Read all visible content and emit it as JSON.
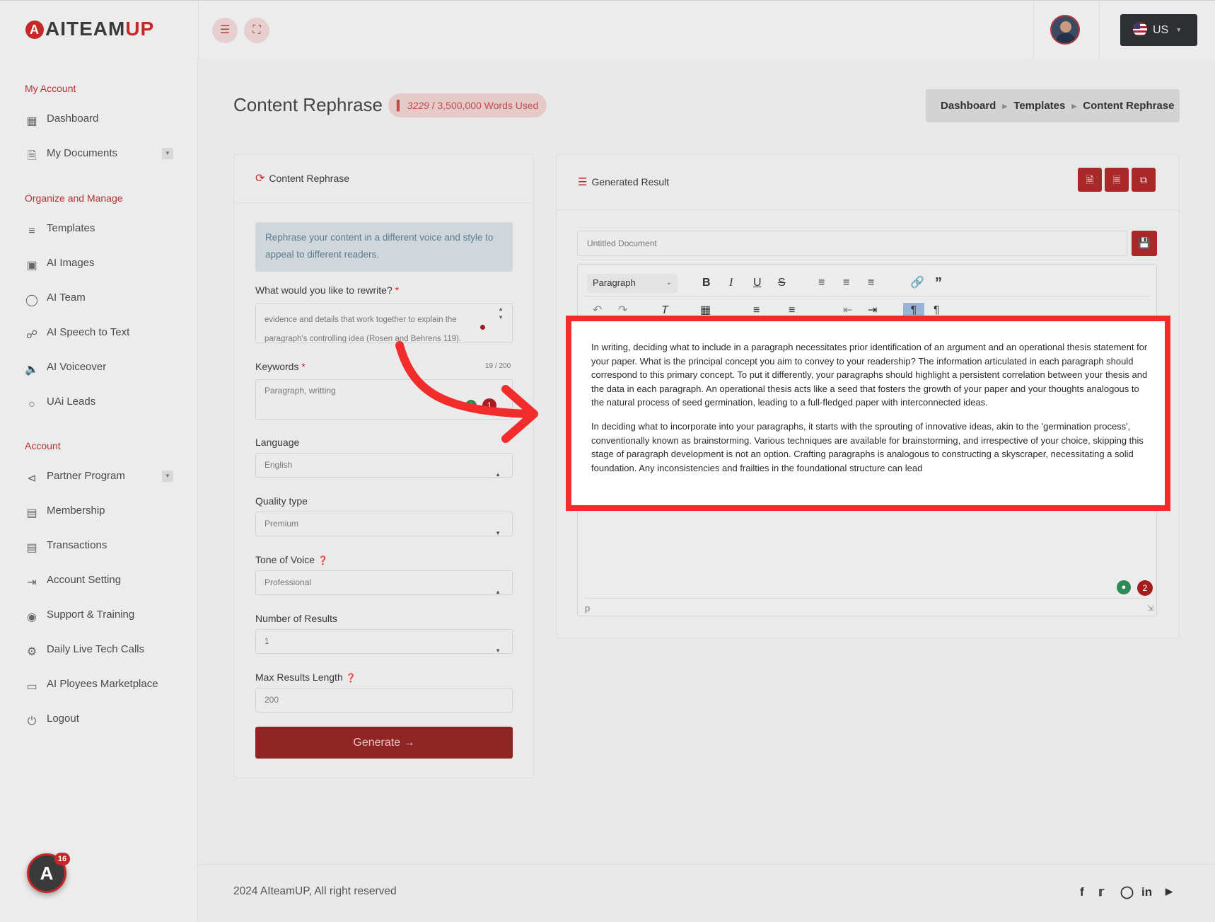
{
  "header": {
    "logo_text": "AITEAM",
    "logo_accent": "UP",
    "logo_mark": "A",
    "menu_icon": "hamburger-icon",
    "fullscreen_icon": "expand-icon",
    "language": "US"
  },
  "sidebar": {
    "sections": [
      {
        "title": "My Account"
      },
      {
        "title": "Organize and Manage"
      },
      {
        "title": "Account"
      }
    ],
    "items": [
      {
        "label": "Dashboard",
        "icon": "grid-icon"
      },
      {
        "label": "My Documents",
        "icon": "document-icon"
      },
      {
        "label": "Templates",
        "icon": "layers-icon"
      },
      {
        "label": "AI Images",
        "icon": "image-icon"
      },
      {
        "label": "AI Team",
        "icon": "chat-icon"
      },
      {
        "label": "AI Speech to Text",
        "icon": "headphones-icon"
      },
      {
        "label": "AI Voiceover",
        "icon": "speaker-icon"
      },
      {
        "label": "UAi Leads",
        "icon": "circle-icon"
      },
      {
        "label": "Partner Program",
        "icon": "share-icon"
      },
      {
        "label": "Membership",
        "icon": "gift-icon"
      },
      {
        "label": "Transactions",
        "icon": "receipt-icon"
      },
      {
        "label": "Account Setting",
        "icon": "exit-icon"
      },
      {
        "label": "Support & Training",
        "icon": "eye-icon"
      },
      {
        "label": "Daily Live Tech Calls",
        "icon": "gear-icon"
      },
      {
        "label": "AI Ployees Marketplace",
        "icon": "monitor-icon"
      },
      {
        "label": "Logout",
        "icon": "power-icon"
      }
    ],
    "help_badge_count": "16"
  },
  "page": {
    "title": "Content Rephrase",
    "words_used": "3229",
    "words_total": "/ 3,500,000 Words Used",
    "breadcrumb": [
      "Dashboard",
      "Templates",
      "Content Rephrase"
    ]
  },
  "form": {
    "card_title": "Content Rephrase",
    "info": "Rephrase your content in a different voice and style to appeal to different readers.",
    "rewrite_label": "What would you like to rewrite?",
    "rewrite_value": "evidence and details that work together to explain the paragraph's controlling idea (Rosen and Behrens 119).",
    "keywords_label": "Keywords",
    "keywords_count": "19 / 200",
    "keywords_value": "Paragraph, writting",
    "keywords_badge": "1",
    "language_label": "Language",
    "language_value": "English",
    "quality_label": "Quality type",
    "quality_value": "Premium",
    "tone_label": "Tone of Voice",
    "tone_value": "Professional",
    "results_label": "Number of Results",
    "results_value": "1",
    "max_length_label": "Max Results Length",
    "max_length_value": "200",
    "generate_label": "Generate"
  },
  "result": {
    "card_title": "Generated Result",
    "doc_title_placeholder": "Untitled Document",
    "paragraph_select": "Paragraph",
    "paragraph_1": "In writing, deciding what to include in a paragraph necessitates prior identification of an argument and an operational thesis statement for your paper. What is the principal concept you aim to convey to your readership? The information articulated in each paragraph should correspond to this primary concept. To put it differently, your paragraphs should highlight a persistent correlation between your thesis and the data in each paragraph. An operational thesis acts like a seed that fosters the growth of your paper and your thoughts analogous to the natural process of seed germination, leading to a full-fledged paper with interconnected ideas.",
    "paragraph_2": "In deciding what to incorporate into your paragraphs, it starts with the sprouting of innovative ideas, akin to the 'germination process', conventionally known as brainstorming. Various techniques are available for brainstorming, and irrespective of your choice, skipping this stage of paragraph development is not an option. Crafting paragraphs is analogous to constructing a skyscraper, necessitating a solid foundation. Any inconsistencies and frailties in the foundational structure can lead",
    "status_path": "p",
    "grammar_badge": "2"
  },
  "footer": {
    "copyright": "2024 AIteamUP, All right reserved",
    "social": [
      "facebook-icon",
      "twitter-icon",
      "instagram-icon",
      "linkedin-icon",
      "youtube-icon"
    ]
  },
  "colors": {
    "accent": "#c62828",
    "highlight_border": "#f22b2b",
    "button_dark": "#8f2424"
  }
}
